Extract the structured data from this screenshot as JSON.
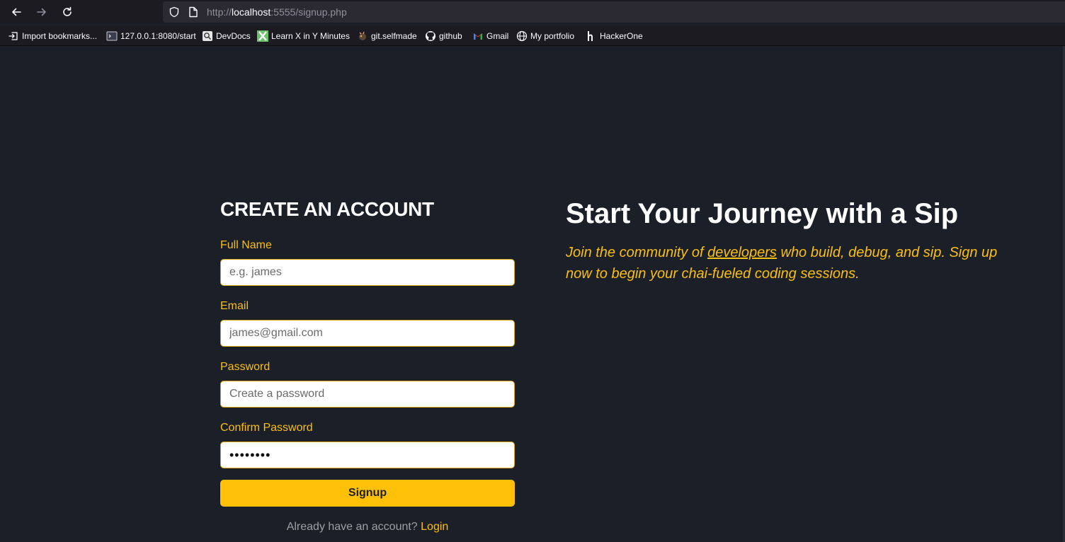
{
  "browser": {
    "url_prefix": "http://",
    "url_host": "localhost",
    "url_rest": ":5555/signup.php",
    "bookmarks": [
      {
        "label": "Import bookmarks...",
        "icon": "import-icon"
      },
      {
        "label": "127.0.0.1:8080/start",
        "icon": "terminal-icon"
      },
      {
        "label": "DevDocs",
        "icon": "devdocs-icon"
      },
      {
        "label": "Learn X in Y Minutes",
        "icon": "learnx-icon"
      },
      {
        "label": "git.selfmade",
        "icon": "git-icon"
      },
      {
        "label": "github",
        "icon": "github-icon"
      },
      {
        "label": "Gmail",
        "icon": "gmail-icon"
      },
      {
        "label": "My portfolio",
        "icon": "globe-icon"
      },
      {
        "label": "HackerOne",
        "icon": "hackerone-icon"
      }
    ]
  },
  "form": {
    "title": "CREATE AN ACCOUNT",
    "full_name": {
      "label": "Full Name",
      "placeholder": "e.g. james",
      "value": ""
    },
    "email": {
      "label": "Email",
      "placeholder": "james@gmail.com",
      "value": ""
    },
    "password": {
      "label": "Password",
      "placeholder": "Create a password",
      "value": ""
    },
    "confirm_password": {
      "label": "Confirm Password",
      "placeholder": "",
      "value": "12345678"
    },
    "submit_label": "Signup",
    "login_prompt": "Already have an account?",
    "login_link": "Login"
  },
  "hero": {
    "title": "Start Your Journey with a Sip",
    "text_before": "Join the community of ",
    "link": "developers",
    "text_after": " who build, debug, and sip. Sign up now to begin your chai-fueled coding sessions."
  },
  "colors": {
    "background": "#1b1f27",
    "accent": "#ffc107",
    "label": "#fbbf0e"
  }
}
